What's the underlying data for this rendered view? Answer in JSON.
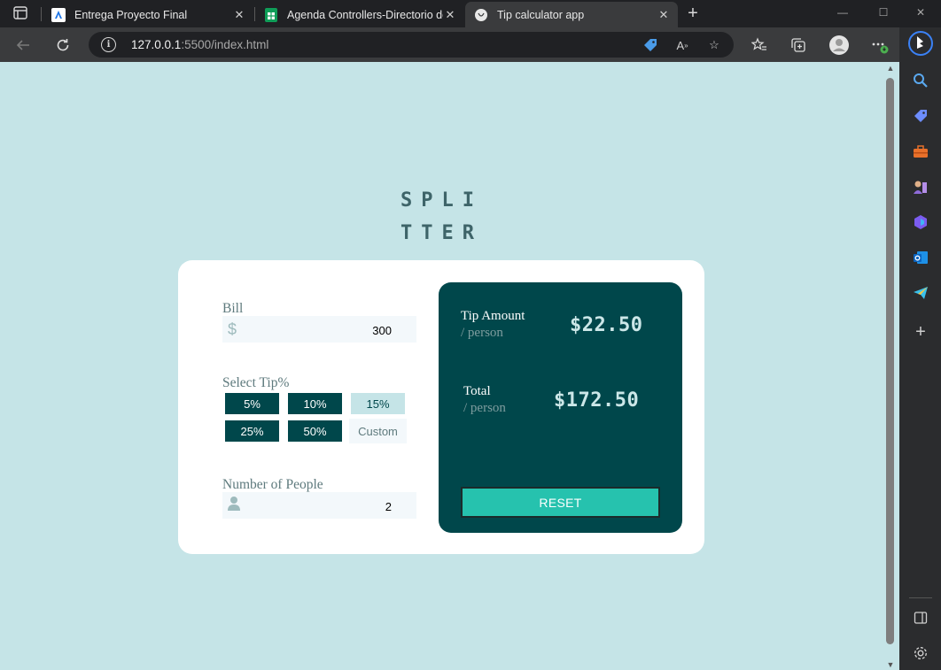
{
  "browser": {
    "tabs": [
      {
        "title": "Entrega Proyecto Final",
        "icon": "classroom-favicon-icon",
        "active": false
      },
      {
        "title": "Agenda Controllers-Directorio de",
        "icon": "sheets-favicon-icon",
        "active": false
      },
      {
        "title": "Tip calculator app",
        "icon": "page-favicon-icon",
        "active": true
      }
    ],
    "new_tab": "+",
    "url_host": "127.0.0.1",
    "url_rest": ":5500/index.html",
    "window_controls": {
      "minimize": "—",
      "maximize": "☐",
      "close": "✕"
    },
    "sidebar_icons": [
      "search-icon",
      "shopping-tag-icon",
      "toolbox-icon",
      "games-icon",
      "copilot-icon",
      "outlook-icon",
      "telegram-icon",
      "add-icon",
      "split-screen-icon",
      "settings-icon"
    ]
  },
  "app": {
    "logo_line1": "SPLI",
    "logo_line2": "TTER",
    "bill": {
      "label": "Bill",
      "prefix": "$",
      "value": "300"
    },
    "tip": {
      "label": "Select Tip%",
      "options": [
        "5%",
        "10%",
        "15%",
        "25%",
        "50%"
      ],
      "selected": "15%",
      "custom_placeholder": "Custom"
    },
    "people": {
      "label": "Number of People",
      "value": "2"
    },
    "results": {
      "tip_label": "Tip Amount",
      "tip_sub": "/ person",
      "tip_amount": "$22.50",
      "total_label": "Total",
      "total_sub": "/ person",
      "total_amount": "$172.50"
    },
    "reset_label": "RESET"
  },
  "colors": {
    "page_bg": "#c5e4e7",
    "dark_cyan": "#00474b",
    "strong_cyan": "#26c2ae",
    "card_bg": "#ffffff",
    "selected_tip_bg": "#c5e4e7"
  }
}
